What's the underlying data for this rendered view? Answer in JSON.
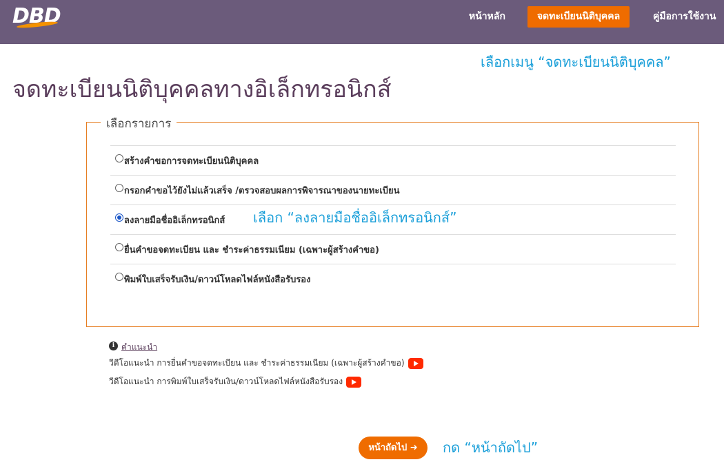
{
  "header": {
    "logo_text": "DBD",
    "nav": {
      "home": "หน้าหลัก",
      "register": "จดทะเบียนนิติบุคคล",
      "manual": "คู่มือการใช้งาน"
    }
  },
  "annotations": {
    "menu": "เลือกเมนู  “จดทะเบียนนิติบุคคล”",
    "sign": "เลือก “ลงลายมือชื่ออิเล็กทรอนิกส์”",
    "next": "กด “หน้าถัดไป”"
  },
  "page_title": "จดทะเบียนนิติบุคคลทางอิเล็กทรอนิกส์",
  "form": {
    "legend": "เลือกรายการ",
    "options": [
      {
        "label": "สร้างคำขอการจดทะเบียนนิติบุคคล",
        "selected": false
      },
      {
        "label": "กรอกคำขอไว้ยังไม่แล้วเสร็จ /ตรวจสอบผลการพิจารณาของนายทะเบียน",
        "selected": false
      },
      {
        "label": "ลงลายมือชื่ออิเล็กทรอนิกส์",
        "selected": true
      },
      {
        "label": "ยื่นคำขอจดทะเบียน และ ชำระค่าธรรมเนียม (เฉพาะผู้สร้างคำขอ)",
        "selected": false
      },
      {
        "label": "พิมพ์ใบเสร็จรับเงิน/ดาวน์โหลดไฟล์หนังสือรับรอง",
        "selected": false
      }
    ]
  },
  "help": {
    "link_label": "คำแนะนำ",
    "video_1": "วีดีโอแนะนำ การยื่นคำขอจดทะเบียน และ ชำระค่าธรรมเนียม (เฉพาะผู้สร้างคำขอ)",
    "video_2": "วีดีโอแนะนำ การพิมพ์ใบเสร็จรับเงิน/ดาวน์โหลดไฟล์หนังสือรับรอง"
  },
  "next_button": {
    "label": "หน้าถัดไป ➜"
  },
  "colors": {
    "nav_bg": "#6b5b7b",
    "accent": "#ef6c00",
    "annotation": "#1a9fd9",
    "title": "#5b3e5c"
  }
}
